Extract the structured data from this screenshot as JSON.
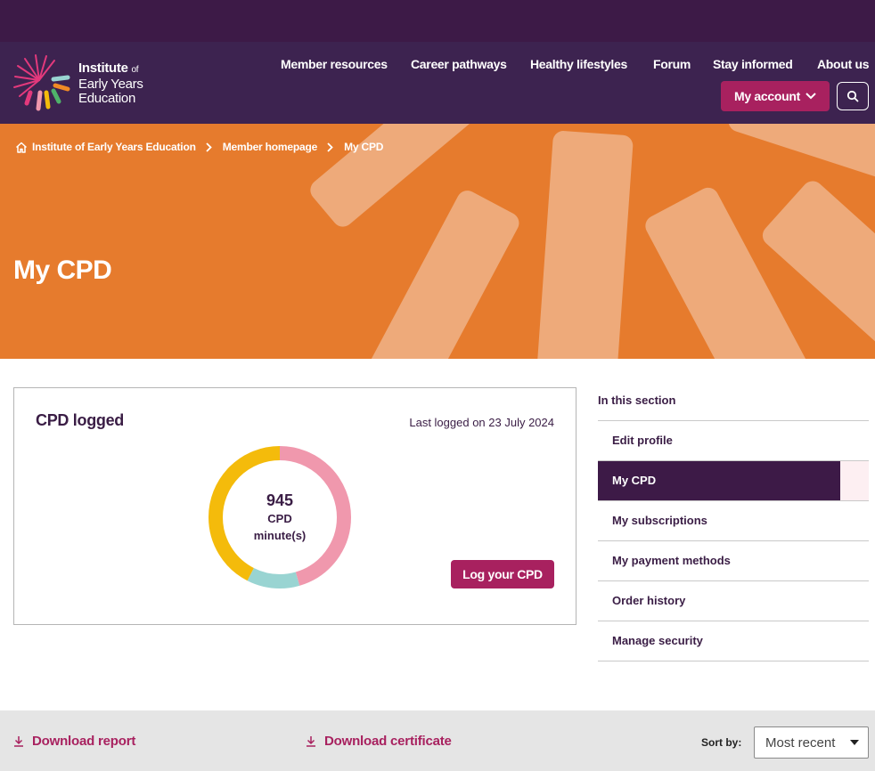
{
  "brand": {
    "line1": "Institute",
    "line1_small": "of",
    "line2": "Early Years",
    "line3": "Education"
  },
  "nav": {
    "items": [
      "Member resources",
      "Career pathways",
      "Healthy lifestyles",
      "Forum",
      "Stay informed",
      "About us"
    ],
    "account_label": "My account"
  },
  "breadcrumb": [
    "Institute of Early Years Education",
    "Member homepage",
    "My CPD"
  ],
  "hero": {
    "title": "My CPD"
  },
  "cpd_card": {
    "title": "CPD logged",
    "last_logged": "Last logged on 23 July 2024",
    "total_value": "945",
    "total_label_line1": "CPD",
    "total_label_line2": "minute(s)",
    "log_button": "Log your CPD",
    "ring_segments": [
      {
        "color": "#f098ad",
        "fraction": 0.455
      },
      {
        "color": "#99d4d2",
        "fraction": 0.12
      },
      {
        "color": "#f4bb0b",
        "fraction": 0.425
      }
    ]
  },
  "section_nav": {
    "heading": "In this section",
    "items": [
      "Edit profile",
      "My CPD",
      "My subscriptions",
      "My payment methods",
      "Order history",
      "Manage security"
    ],
    "active": "My CPD"
  },
  "toolbar": {
    "download_report": "Download report",
    "download_certificate": "Download certificate",
    "sort_label": "Sort by:",
    "sort_value": "Most recent"
  },
  "colors": {
    "header_bg": "#3d2350",
    "hero_bg": "#e67b2d",
    "accent": "#a8215f"
  }
}
